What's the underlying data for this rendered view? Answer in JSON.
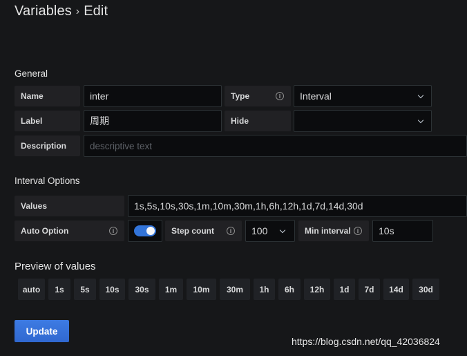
{
  "header": {
    "crumb": "Variables",
    "separator": "›",
    "current": "Edit"
  },
  "general": {
    "section_title": "General",
    "name_label": "Name",
    "name_value": "inter",
    "type_label": "Type",
    "type_value": "Interval",
    "label_label": "Label",
    "label_value": "周期",
    "hide_label": "Hide",
    "hide_value": "",
    "description_label": "Description",
    "description_placeholder": "descriptive text"
  },
  "interval_options": {
    "section_title": "Interval Options",
    "values_label": "Values",
    "values_value": "1s,5s,10s,30s,1m,10m,30m,1h,6h,12h,1d,7d,14d,30d",
    "auto_option_label": "Auto Option",
    "auto_option_enabled": true,
    "step_count_label": "Step count",
    "step_count_value": "100",
    "min_interval_label": "Min interval",
    "min_interval_value": "10s"
  },
  "preview": {
    "section_title": "Preview of values",
    "values": [
      "auto",
      "1s",
      "5s",
      "10s",
      "30s",
      "1m",
      "10m",
      "30m",
      "1h",
      "6h",
      "12h",
      "1d",
      "7d",
      "14d",
      "30d"
    ]
  },
  "actions": {
    "update_label": "Update"
  },
  "watermark": "https://blog.csdn.net/qq_42036824",
  "colors": {
    "background": "#161719",
    "accent": "#3274d9",
    "button": "#3871dc"
  },
  "icons": {
    "info": "info-circle-icon",
    "dropdown": "chevron-down-icon"
  }
}
